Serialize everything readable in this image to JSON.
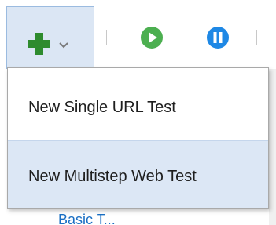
{
  "toolbar": {
    "add_button": {
      "icon": "plus-icon",
      "dropdown_icon": "chevron-down-icon"
    },
    "run_button": {
      "icon": "play-icon",
      "color": "#4caf50"
    },
    "pause_button": {
      "icon": "pause-icon",
      "color": "#1e88e5"
    }
  },
  "menu": {
    "items": [
      {
        "label": "New Single URL Test"
      },
      {
        "label": "New Multistep Web Test"
      }
    ]
  },
  "background": {
    "partial_link_text": "Basic T..."
  },
  "colors": {
    "plus_green": "#2e8b2e",
    "selected_bg": "#dce7f5",
    "button_pressed_bg": "#dbe6f4"
  }
}
